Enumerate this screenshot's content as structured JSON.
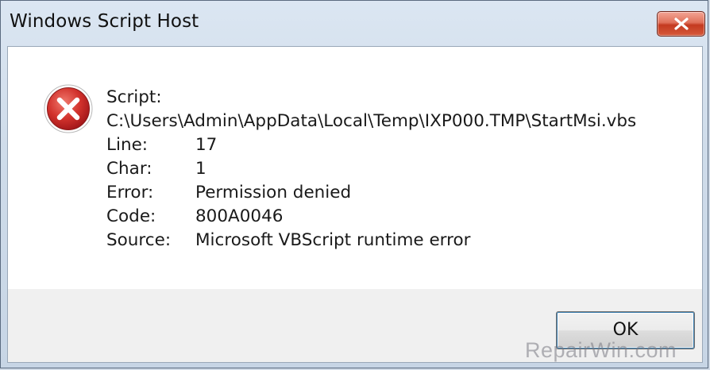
{
  "window": {
    "title": "Windows Script Host"
  },
  "icons": {
    "close": "close-icon",
    "error": "error-icon"
  },
  "message": {
    "script_label": "Script:",
    "script_path": "C:\\Users\\Admin\\AppData\\Local\\Temp\\IXP000.TMP\\StartMsi.vbs",
    "fields": [
      {
        "label": "Line:",
        "value": "17"
      },
      {
        "label": "Char:",
        "value": "1"
      },
      {
        "label": "Error:",
        "value": "Permission denied"
      },
      {
        "label": "Code:",
        "value": "800A0046"
      },
      {
        "label": "Source:",
        "value": "Microsoft VBScript runtime error"
      }
    ]
  },
  "buttons": {
    "ok_label": "OK"
  },
  "watermark": "RepairWin.com",
  "colors": {
    "close_button": "#c43a20",
    "error_icon": "#c8262b",
    "ok_focus_border": "#3c7fb1"
  }
}
